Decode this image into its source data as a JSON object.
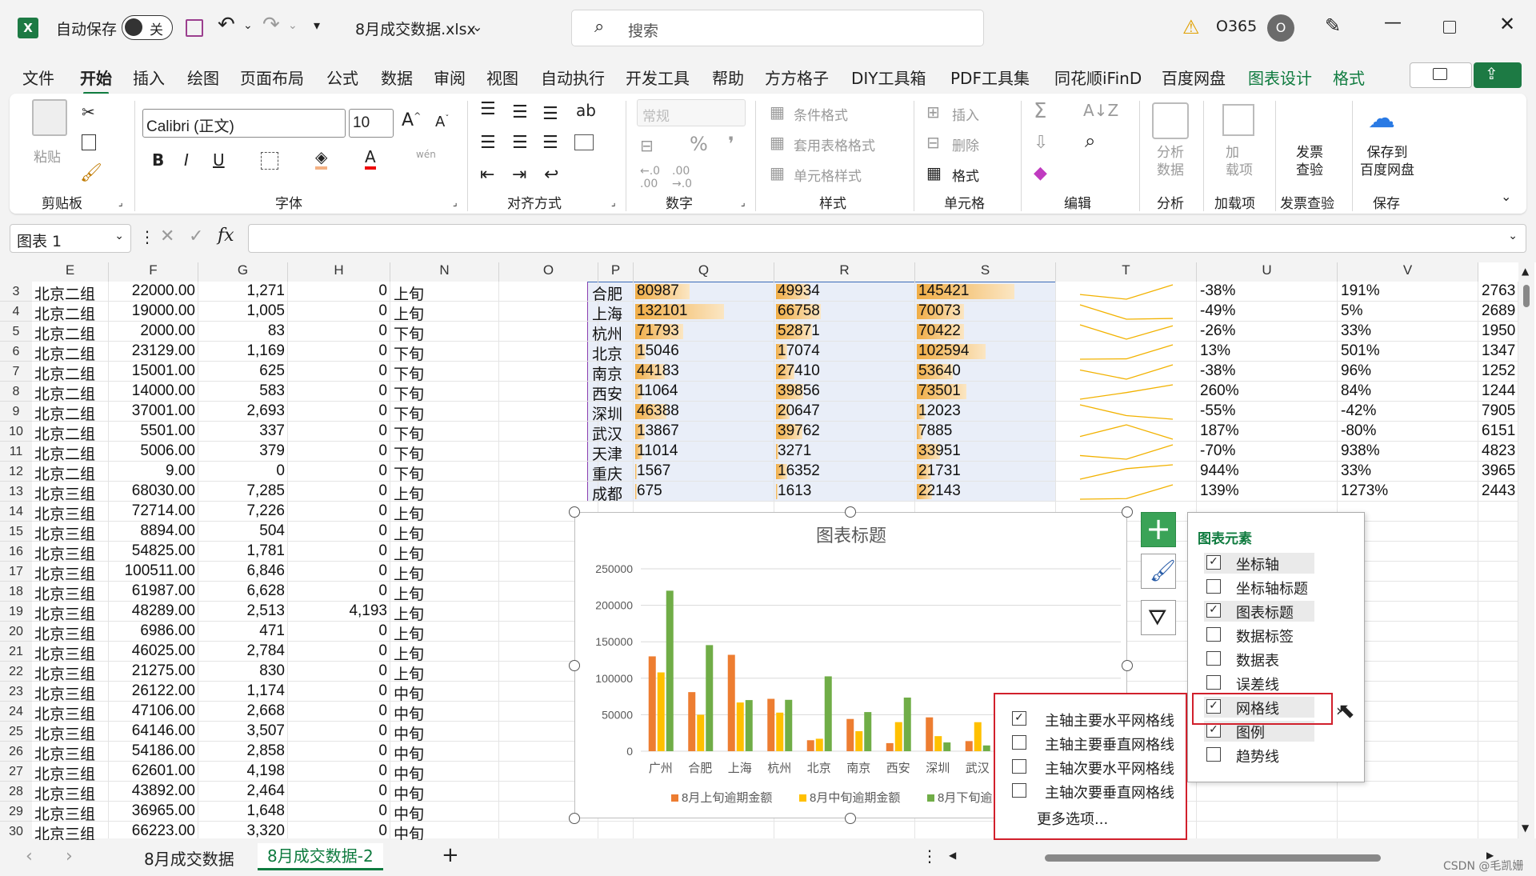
{
  "titlebar": {
    "autosave_label": "自动保存",
    "autosave_state": "关",
    "filename": "8月成交数据.xlsx",
    "search_placeholder": "搜索",
    "account": "O365",
    "avatar_letter": "O"
  },
  "tabs": [
    "文件",
    "开始",
    "插入",
    "绘图",
    "页面布局",
    "公式",
    "数据",
    "审阅",
    "视图",
    "自动执行",
    "开发工具",
    "帮助",
    "方方格子",
    "DIY工具箱",
    "PDF工具集",
    "同花顺iFinD",
    "百度网盘",
    "图表设计",
    "格式"
  ],
  "ribbon": {
    "paste": "粘贴",
    "font_name": "Calibri (正文)",
    "font_size": "10",
    "wen": "wén",
    "number_format": "常规",
    "cond_format": "条件格式",
    "table_format": "套用表格格式",
    "cell_style": "单元格样式",
    "insert": "插入",
    "delete": "删除",
    "format": "格式",
    "analyze": "分析\n数据",
    "addin": "加\n载项",
    "invoice": "发票\n查验",
    "save_baidu": "保存到\n百度网盘",
    "groups": [
      "剪贴板",
      "字体",
      "对齐方式",
      "数字",
      "样式",
      "单元格",
      "编辑",
      "分析",
      "加载项",
      "发票查验",
      "保存"
    ]
  },
  "formula": {
    "namebox": "图表 1",
    "fx": "fx"
  },
  "col_headers": [
    "E",
    "F",
    "G",
    "H",
    "N",
    "O",
    "P",
    "Q",
    "R",
    "S",
    "T",
    "U",
    "V"
  ],
  "rows": [
    {
      "n": "3",
      "e": "北京二组",
      "f": "22000.00",
      "g": "1,271",
      "h": "0",
      "ncol": "上旬"
    },
    {
      "n": "4",
      "e": "北京二组",
      "f": "19000.00",
      "g": "1,005",
      "h": "0",
      "ncol": "上旬"
    },
    {
      "n": "5",
      "e": "北京二组",
      "f": "2000.00",
      "g": "83",
      "h": "0",
      "ncol": "下旬"
    },
    {
      "n": "6",
      "e": "北京二组",
      "f": "23129.00",
      "g": "1,169",
      "h": "0",
      "ncol": "下旬"
    },
    {
      "n": "7",
      "e": "北京二组",
      "f": "15001.00",
      "g": "625",
      "h": "0",
      "ncol": "下旬"
    },
    {
      "n": "8",
      "e": "北京二组",
      "f": "14000.00",
      "g": "583",
      "h": "0",
      "ncol": "下旬"
    },
    {
      "n": "9",
      "e": "北京二组",
      "f": "37001.00",
      "g": "2,693",
      "h": "0",
      "ncol": "下旬"
    },
    {
      "n": "10",
      "e": "北京二组",
      "f": "5501.00",
      "g": "337",
      "h": "0",
      "ncol": "下旬"
    },
    {
      "n": "11",
      "e": "北京二组",
      "f": "5006.00",
      "g": "379",
      "h": "0",
      "ncol": "下旬"
    },
    {
      "n": "12",
      "e": "北京二组",
      "f": "9.00",
      "g": "0",
      "h": "0",
      "ncol": "下旬"
    },
    {
      "n": "13",
      "e": "北京三组",
      "f": "68030.00",
      "g": "7,285",
      "h": "0",
      "ncol": "上旬"
    },
    {
      "n": "14",
      "e": "北京三组",
      "f": "72714.00",
      "g": "7,226",
      "h": "0",
      "ncol": "上旬"
    },
    {
      "n": "15",
      "e": "北京三组",
      "f": "8894.00",
      "g": "504",
      "h": "0",
      "ncol": "上旬"
    },
    {
      "n": "16",
      "e": "北京三组",
      "f": "54825.00",
      "g": "1,781",
      "h": "0",
      "ncol": "上旬"
    },
    {
      "n": "17",
      "e": "北京三组",
      "f": "100511.00",
      "g": "6,846",
      "h": "0",
      "ncol": "上旬"
    },
    {
      "n": "18",
      "e": "北京三组",
      "f": "61987.00",
      "g": "6,628",
      "h": "0",
      "ncol": "上旬"
    },
    {
      "n": "19",
      "e": "北京三组",
      "f": "48289.00",
      "g": "2,513",
      "h": "4,193",
      "ncol": "上旬"
    },
    {
      "n": "20",
      "e": "北京三组",
      "f": "6986.00",
      "g": "471",
      "h": "0",
      "ncol": "上旬"
    },
    {
      "n": "21",
      "e": "北京三组",
      "f": "46025.00",
      "g": "2,784",
      "h": "0",
      "ncol": "上旬"
    },
    {
      "n": "22",
      "e": "北京三组",
      "f": "21275.00",
      "g": "830",
      "h": "0",
      "ncol": "上旬"
    },
    {
      "n": "23",
      "e": "北京三组",
      "f": "26122.00",
      "g": "1,174",
      "h": "0",
      "ncol": "中旬"
    },
    {
      "n": "24",
      "e": "北京三组",
      "f": "47106.00",
      "g": "2,668",
      "h": "0",
      "ncol": "中旬"
    },
    {
      "n": "25",
      "e": "北京三组",
      "f": "64146.00",
      "g": "3,507",
      "h": "0",
      "ncol": "中旬"
    },
    {
      "n": "26",
      "e": "北京三组",
      "f": "54186.00",
      "g": "2,858",
      "h": "0",
      "ncol": "中旬"
    },
    {
      "n": "27",
      "e": "北京三组",
      "f": "62601.00",
      "g": "4,198",
      "h": "0",
      "ncol": "中旬"
    },
    {
      "n": "28",
      "e": "北京三组",
      "f": "43892.00",
      "g": "2,464",
      "h": "0",
      "ncol": "中旬"
    },
    {
      "n": "29",
      "e": "北京三组",
      "f": "36965.00",
      "g": "1,648",
      "h": "0",
      "ncol": "中旬"
    },
    {
      "n": "30",
      "e": "北京三组",
      "f": "66223.00",
      "g": "3,320",
      "h": "0",
      "ncol": "中旬"
    }
  ],
  "city_table": [
    {
      "p": "合肥",
      "q": "80987",
      "r": "49934",
      "s": "145421",
      "u": "-38%",
      "v": "191%",
      "w": "2763"
    },
    {
      "p": "上海",
      "q": "132101",
      "r": "66758",
      "s": "70073",
      "u": "-49%",
      "v": "5%",
      "w": "2689"
    },
    {
      "p": "杭州",
      "q": "71793",
      "r": "52871",
      "s": "70422",
      "u": "-26%",
      "v": "33%",
      "w": "1950"
    },
    {
      "p": "北京",
      "q": "15046",
      "r": "17074",
      "s": "102594",
      "u": "13%",
      "v": "501%",
      "w": "1347"
    },
    {
      "p": "南京",
      "q": "44183",
      "r": "27410",
      "s": "53640",
      "u": "-38%",
      "v": "96%",
      "w": "1252"
    },
    {
      "p": "西安",
      "q": "11064",
      "r": "39856",
      "s": "73501",
      "u": "260%",
      "v": "84%",
      "w": "1244"
    },
    {
      "p": "深圳",
      "q": "46388",
      "r": "20647",
      "s": "12023",
      "u": "-55%",
      "v": "-42%",
      "w": "7905"
    },
    {
      "p": "武汉",
      "q": "13867",
      "r": "39762",
      "s": "7885",
      "u": "187%",
      "v": "-80%",
      "w": "6151"
    },
    {
      "p": "天津",
      "q": "11014",
      "r": "3271",
      "s": "33951",
      "u": "-70%",
      "v": "938%",
      "w": "4823"
    },
    {
      "p": "重庆",
      "q": "1567",
      "r": "16352",
      "s": "21731",
      "u": "944%",
      "v": "33%",
      "w": "3965"
    },
    {
      "p": "成都",
      "q": "675",
      "r": "1613",
      "s": "22143",
      "u": "139%",
      "v": "1273%",
      "w": "2443"
    }
  ],
  "chart_data": {
    "type": "bar",
    "title": "图表标题",
    "categories": [
      "广州",
      "合肥",
      "上海",
      "杭州",
      "北京",
      "南京",
      "西安",
      "深圳",
      "武汉"
    ],
    "yticks": [
      "250000",
      "200000",
      "150000",
      "100000",
      "50000",
      "0"
    ],
    "ylim": [
      0,
      250000
    ],
    "grid": true,
    "legend": "bottom",
    "series": [
      {
        "name": "8月上旬逾期金额",
        "color": "#ed7d31",
        "values": [
          130000,
          80987,
          132101,
          71793,
          15046,
          44183,
          11064,
          46388,
          13867
        ]
      },
      {
        "name": "8月中旬逾期金额",
        "color": "#ffc000",
        "values": [
          108000,
          49934,
          66758,
          52871,
          17074,
          27410,
          39856,
          20647,
          39762
        ]
      },
      {
        "name": "8月下旬逾",
        "color": "#70ad47",
        "values": [
          220000,
          145421,
          70073,
          70422,
          102594,
          53640,
          73501,
          12023,
          7885
        ]
      }
    ]
  },
  "popup": {
    "title": "图表元素",
    "items": [
      {
        "label": "坐标轴",
        "checked": true
      },
      {
        "label": "坐标轴标题",
        "checked": false
      },
      {
        "label": "图表标题",
        "checked": true
      },
      {
        "label": "数据标签",
        "checked": false
      },
      {
        "label": "数据表",
        "checked": false
      },
      {
        "label": "误差线",
        "checked": false
      },
      {
        "label": "网格线",
        "checked": true
      },
      {
        "label": "图例",
        "checked": true
      },
      {
        "label": "趋势线",
        "checked": false
      }
    ]
  },
  "subpopup": {
    "items": [
      {
        "label": "主轴主要水平网格线",
        "checked": true
      },
      {
        "label": "主轴主要垂直网格线",
        "checked": false
      },
      {
        "label": "主轴次要水平网格线",
        "checked": false
      },
      {
        "label": "主轴次要垂直网格线",
        "checked": false
      }
    ],
    "more": "更多选项..."
  },
  "sheets": [
    "8月成交数据",
    "8月成交数据-2"
  ],
  "watermark": "CSDN @毛凯姗"
}
